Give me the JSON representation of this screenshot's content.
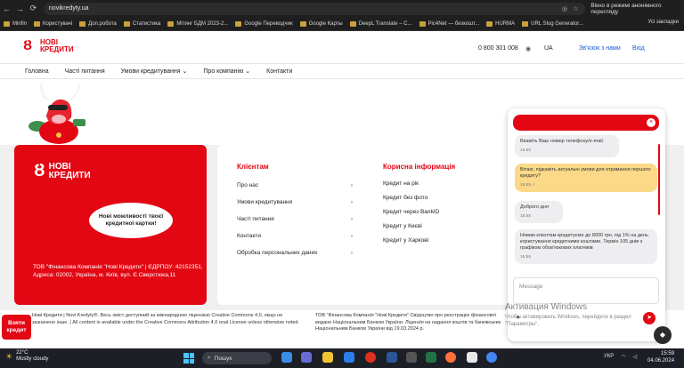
{
  "browser": {
    "url": "novikredyty.ua",
    "incognito_label": "Вікно в режимі анонімного перегляду",
    "nav": {
      "back": "←",
      "forward": "→",
      "reload": "⟳"
    },
    "bookmarks": [
      "Minfin",
      "Користувачі",
      "Доп.робота",
      "Статистика",
      "Мітинг БДМ 2023-2...",
      "Google Переводчик",
      "Google Карты",
      "DeepL Translate – С...",
      "Pic4Net — безкошт...",
      "HURMA",
      "URL Slug Generator..."
    ],
    "bookmarks_all": "Усі закладки"
  },
  "header": {
    "logo_line1": "НОВІ",
    "logo_line2": "КРЕДИТИ",
    "phone": "0 800 301 008",
    "lang": "UA",
    "callback": "Зв'язок з нами",
    "login": "Вхід",
    "menu": [
      "Головна",
      "Часті питання",
      "Умови кредитування ⌄",
      "Про компанію ⌄",
      "Контакти"
    ]
  },
  "red_card": {
    "logo_line1": "НОВІ",
    "logo_line2": "КРЕДИТИ",
    "bubble": "Нові можливості твоєї кредитної картки!",
    "company": "ТОВ \"Фінансова Компанія \"Нові Кредити\" | ЄДРПОУ: 42152351, Адреса: 02002, Україна, м. Київ, вул. Є.Сверстюка,11"
  },
  "clients": {
    "title": "Клієнтам",
    "items": [
      "Про нас",
      "Умови кредитування",
      "Часті питання",
      "Контакти",
      "Обробка персональних даних"
    ]
  },
  "useful": {
    "title": "Корисна інформація",
    "items": [
      "Кредит на рік",
      "Кредит без фото",
      "Кредит через BankID",
      "Кредит у Києві",
      "Кредит у Харкові"
    ]
  },
  "footer": {
    "left": "Нові Кредити | Novi Kredyty®. Весь зміст доступний за міжнародною ліцензією Creative Commons 4.0, якщо не зазначено інше. | All content is available under the Creative Commons Attribution 4.0 onal License unless otherwise noted.",
    "right": "ТОВ \"Фінансова Компанія \"Нові Кредити\" Свідоцтво про реєстрацію фінансової видано Національним Банком України. Ліцензія на надання коштів та банківських Національним Банком України від 19.03.2024 р."
  },
  "take_credit": "Взяти кредит",
  "chat": {
    "messages": [
      {
        "text": "Вкажіть Ваш номер телефону/e-mail.",
        "time": "15:55"
      },
      {
        "text": "Вітаю, підкажіть актуальні умови для отримання першого кредиту?",
        "time": "15:55 ✓"
      },
      {
        "text": "Доброго дня",
        "time": "15:55"
      },
      {
        "text": "Новим клієнтам кредитуємо до 8000 грн, під 1% на день користування кредитними коштами. Термін 105 днів з графіком обов'язкових платежів",
        "time": "15:56"
      }
    ],
    "input_placeholder": "Message",
    "close": "×",
    "send": "➤",
    "attach": "⏺",
    "fab": "◆"
  },
  "activation": {
    "title": "Активация Windows",
    "sub": "Чтобы активировать Windows, перейдите в раздел \"Параметры\"."
  },
  "taskbar": {
    "temp": "22°C",
    "weather": "Mostly cloudy",
    "search": "Пошук",
    "lang": "УКР",
    "time": "15:59",
    "date": "04.06.2024"
  }
}
